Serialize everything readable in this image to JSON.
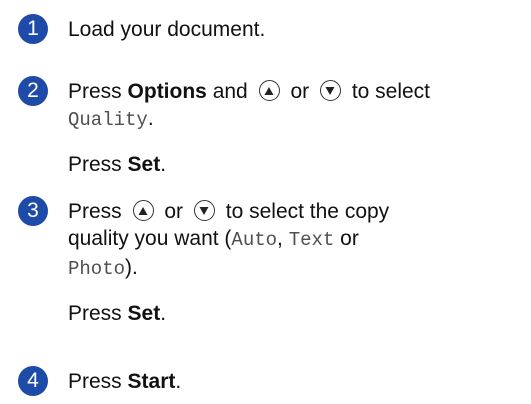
{
  "theme": {
    "step_circle_color": "#1e4aa8"
  },
  "icons": {
    "up_key": "up-arrow-key-icon",
    "down_key": "down-arrow-key-icon"
  },
  "steps": [
    {
      "number": "1",
      "text": "Load your document."
    },
    {
      "number": "2",
      "press": "Press",
      "options": "Options",
      "and": "and",
      "or": "or",
      "to_select": "to select",
      "menu_item": "Quality",
      "period": ".",
      "press2": "Press",
      "set": "Set",
      "period2": "."
    },
    {
      "number": "3",
      "press": "Press",
      "or": "or",
      "to_select_copy": "to select the copy",
      "quality_you_want": "quality you want (",
      "opt_auto": "Auto",
      "comma": ",",
      "opt_text": "Text",
      "or2": "or",
      "opt_photo": "Photo",
      "close": ").",
      "press2": "Press",
      "set": "Set",
      "period2": "."
    },
    {
      "number": "4",
      "press": "Press",
      "start": "Start",
      "period": "."
    }
  ]
}
